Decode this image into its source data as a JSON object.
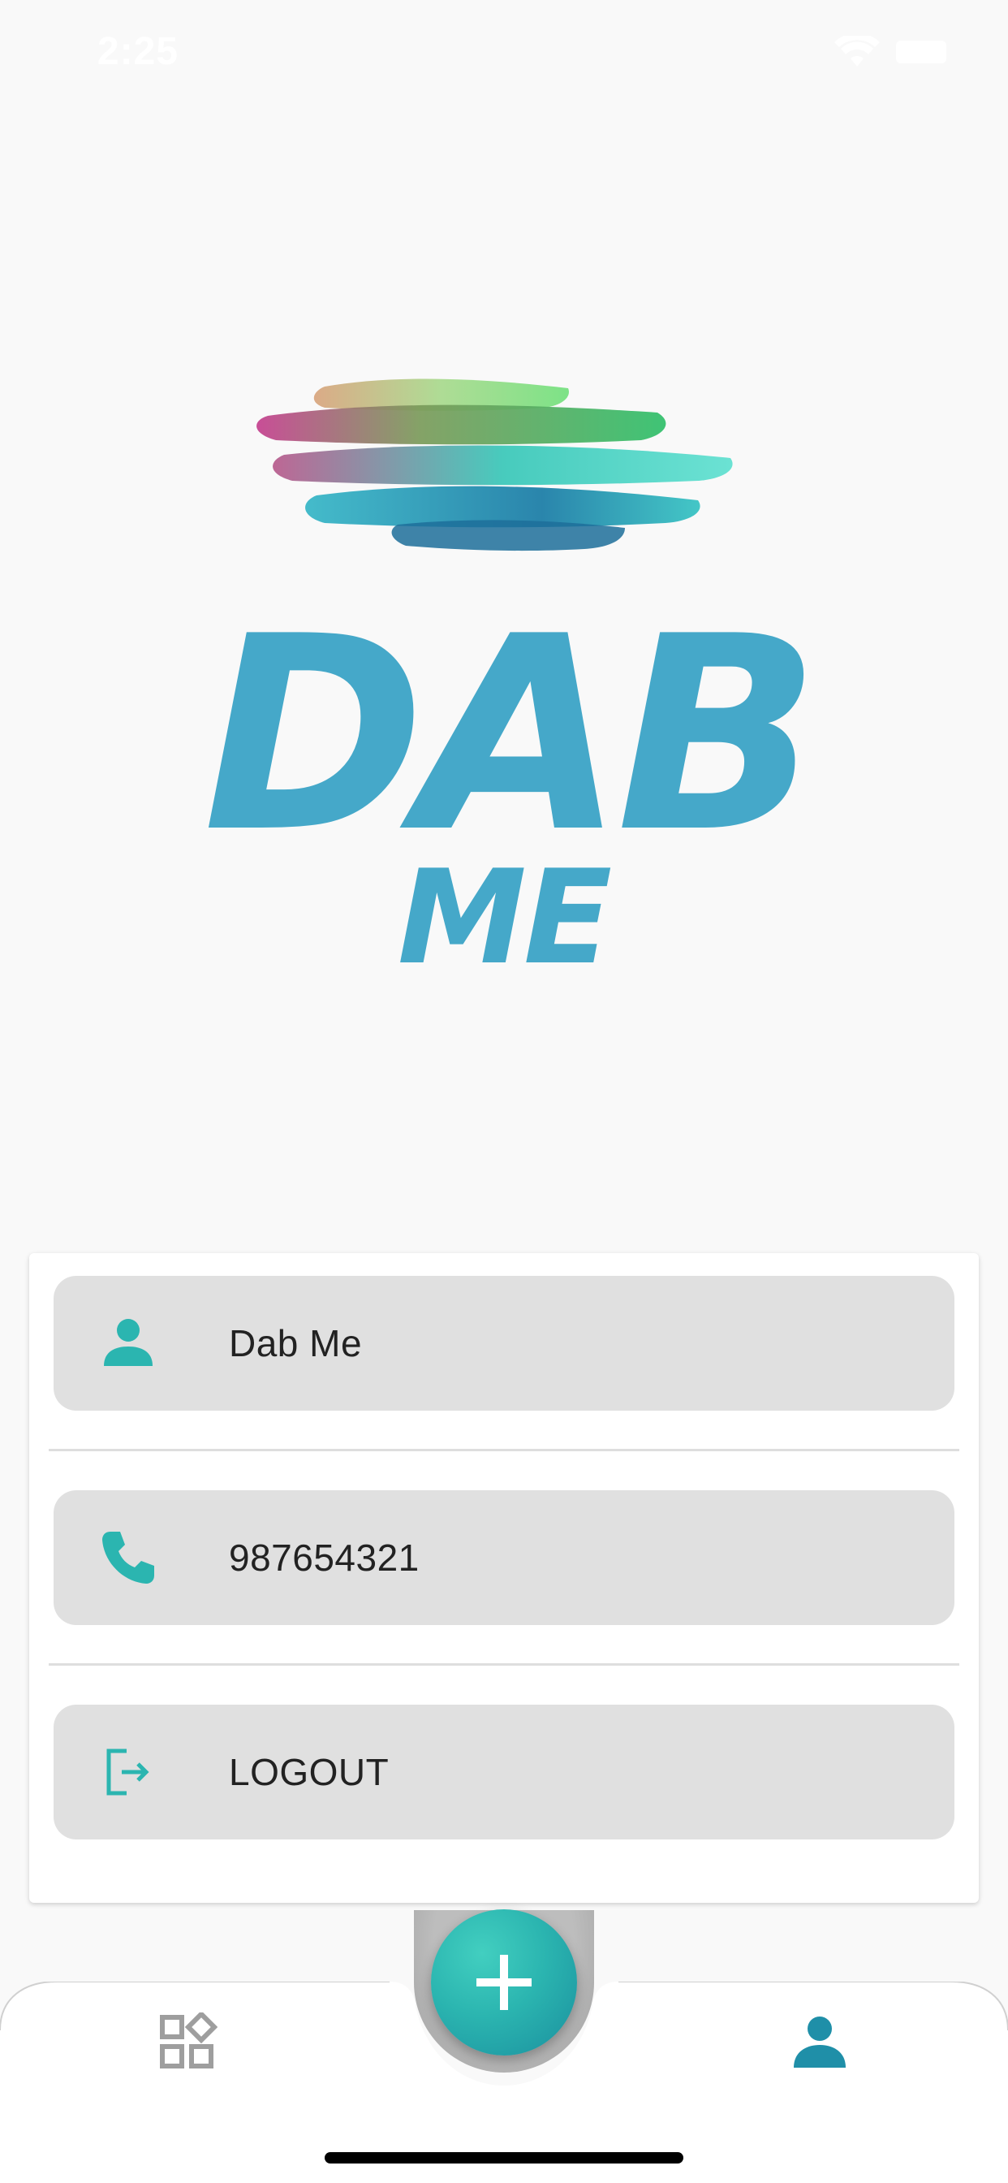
{
  "status_bar": {
    "time": "2:25",
    "wifi_icon": "wifi-icon",
    "battery_icon": "battery-icon"
  },
  "logo": {
    "title": "DAB",
    "subtitle": "ME"
  },
  "profile": {
    "name": "Dab Me",
    "phone": "987654321",
    "logout_label": "LOGOUT"
  },
  "icons": {
    "user": "person-icon",
    "phone": "phone-icon",
    "logout": "logout-icon",
    "add": "plus-icon",
    "dashboard": "dashboard-icon",
    "profile": "profile-icon"
  },
  "colors": {
    "accent": "#2bb5b0",
    "logo_blue": "#45a8c9",
    "nav_active": "#1f8fa8",
    "nav_inactive": "#9e9e9e",
    "row_background": "#e0e0e0"
  },
  "bottom_nav": {
    "active_tab": "profile"
  }
}
